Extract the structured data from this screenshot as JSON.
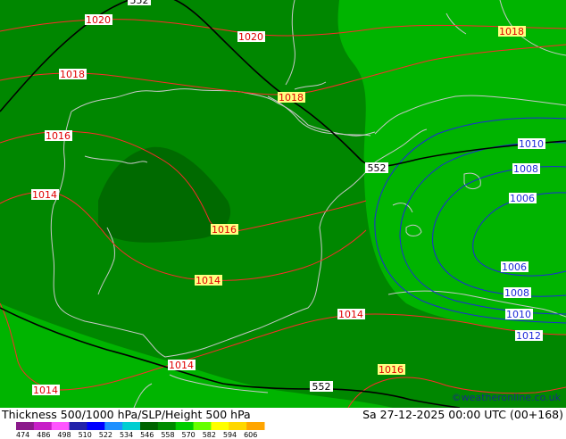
{
  "footer": {
    "title": "Thickness 500/1000 hPa/SLP/Height 500 hPa",
    "datetime": "Sa 27-12-2025 00:00 UTC (00+168)",
    "credit": "©weatheronline.co.uk",
    "scale_ticks": [
      "474",
      "486",
      "498",
      "510",
      "522",
      "534",
      "546",
      "558",
      "570",
      "582",
      "594",
      "606"
    ],
    "scale_colors": [
      "#8b1a8b",
      "#c71fc7",
      "#ff55ff",
      "#2222aa",
      "#0000ff",
      "#1e90ff",
      "#00ced1",
      "#006400",
      "#008b00",
      "#00cd00",
      "#66ff00",
      "#ffff00",
      "#ffd700",
      "#ffa500"
    ]
  },
  "map": {
    "colors": {
      "thickness_bg": "#008700",
      "thickness_light": "#00b400",
      "thickness_dark": "#006a00",
      "isobar_low": "#1c2ad8",
      "isobar_high": "#ff2a2a",
      "height_line": "#000000",
      "coast": "#c8c8c8"
    },
    "labels": {
      "h552_top": "552",
      "h552_mid": "552",
      "h552_bot": "552",
      "p1020_a": "1020",
      "p1020_b": "1020",
      "p1018_a": "1018",
      "p1018_b": "1018",
      "p1018_c": "1018",
      "p1016_a": "1016",
      "p1016_b": "1016",
      "p1016_c": "1016",
      "p1014_a": "1014",
      "p1014_b": "1014",
      "p1014_c": "1014",
      "p1014_d": "1014",
      "p1014_e": "1014",
      "p1012": "1012",
      "p1010_a": "1010",
      "p1010_b": "1010",
      "p1008_a": "1008",
      "p1008_b": "1008",
      "p1006_a": "1006",
      "p1006_b": "1006"
    }
  }
}
